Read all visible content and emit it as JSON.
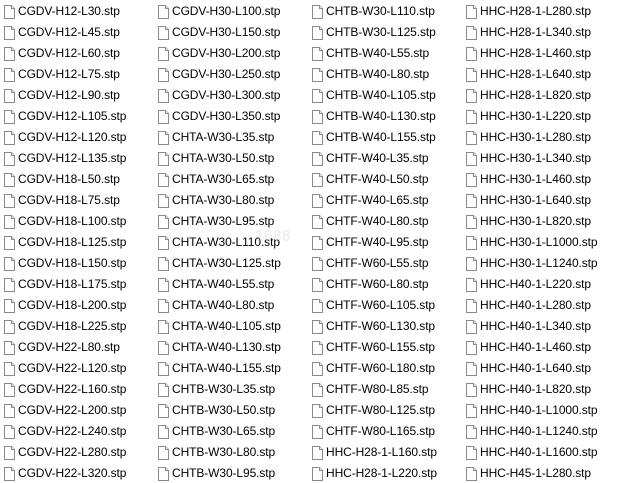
{
  "icon": "blank-document-icon",
  "watermark": "1688",
  "columns": [
    [
      "CGDV-H12-L30.stp",
      "CGDV-H12-L45.stp",
      "CGDV-H12-L60.stp",
      "CGDV-H12-L75.stp",
      "CGDV-H12-L90.stp",
      "CGDV-H12-L105.stp",
      "CGDV-H12-L120.stp",
      "CGDV-H12-L135.stp",
      "CGDV-H18-L50.stp",
      "CGDV-H18-L75.stp",
      "CGDV-H18-L100.stp",
      "CGDV-H18-L125.stp",
      "CGDV-H18-L150.stp",
      "CGDV-H18-L175.stp",
      "CGDV-H18-L200.stp",
      "CGDV-H18-L225.stp",
      "CGDV-H22-L80.stp",
      "CGDV-H22-L120.stp",
      "CGDV-H22-L160.stp",
      "CGDV-H22-L200.stp",
      "CGDV-H22-L240.stp",
      "CGDV-H22-L280.stp",
      "CGDV-H22-L320.stp"
    ],
    [
      "CGDV-H30-L100.stp",
      "CGDV-H30-L150.stp",
      "CGDV-H30-L200.stp",
      "CGDV-H30-L250.stp",
      "CGDV-H30-L300.stp",
      "CGDV-H30-L350.stp",
      "CHTA-W30-L35.stp",
      "CHTA-W30-L50.stp",
      "CHTA-W30-L65.stp",
      "CHTA-W30-L80.stp",
      "CHTA-W30-L95.stp",
      "CHTA-W30-L110.stp",
      "CHTA-W30-L125.stp",
      "CHTA-W40-L55.stp",
      "CHTA-W40-L80.stp",
      "CHTA-W40-L105.stp",
      "CHTA-W40-L130.stp",
      "CHTA-W40-L155.stp",
      "CHTB-W30-L35.stp",
      "CHTB-W30-L50.stp",
      "CHTB-W30-L65.stp",
      "CHTB-W30-L80.stp",
      "CHTB-W30-L95.stp"
    ],
    [
      "CHTB-W30-L110.stp",
      "CHTB-W30-L125.stp",
      "CHTB-W40-L55.stp",
      "CHTB-W40-L80.stp",
      "CHTB-W40-L105.stp",
      "CHTB-W40-L130.stp",
      "CHTB-W40-L155.stp",
      "CHTF-W40-L35.stp",
      "CHTF-W40-L50.stp",
      "CHTF-W40-L65.stp",
      "CHTF-W40-L80.stp",
      "CHTF-W40-L95.stp",
      "CHTF-W60-L55.stp",
      "CHTF-W60-L80.stp",
      "CHTF-W60-L105.stp",
      "CHTF-W60-L130.stp",
      "CHTF-W60-L155.stp",
      "CHTF-W60-L180.stp",
      "CHTF-W80-L85.stp",
      "CHTF-W80-L125.stp",
      "CHTF-W80-L165.stp",
      "HHC-H28-1-L160.stp",
      "HHC-H28-1-L220.stp"
    ],
    [
      "HHC-H28-1-L280.stp",
      "HHC-H28-1-L340.stp",
      "HHC-H28-1-L460.stp",
      "HHC-H28-1-L640.stp",
      "HHC-H28-1-L820.stp",
      "HHC-H30-1-L220.stp",
      "HHC-H30-1-L280.stp",
      "HHC-H30-1-L340.stp",
      "HHC-H30-1-L460.stp",
      "HHC-H30-1-L640.stp",
      "HHC-H30-1-L820.stp",
      "HHC-H30-1-L1000.stp",
      "HHC-H30-1-L1240.stp",
      "HHC-H40-1-L220.stp",
      "HHC-H40-1-L280.stp",
      "HHC-H40-1-L340.stp",
      "HHC-H40-1-L460.stp",
      "HHC-H40-1-L640.stp",
      "HHC-H40-1-L820.stp",
      "HHC-H40-1-L1000.stp",
      "HHC-H40-1-L1240.stp",
      "HHC-H40-1-L1600.stp",
      "HHC-H45-1-L280.stp"
    ]
  ]
}
